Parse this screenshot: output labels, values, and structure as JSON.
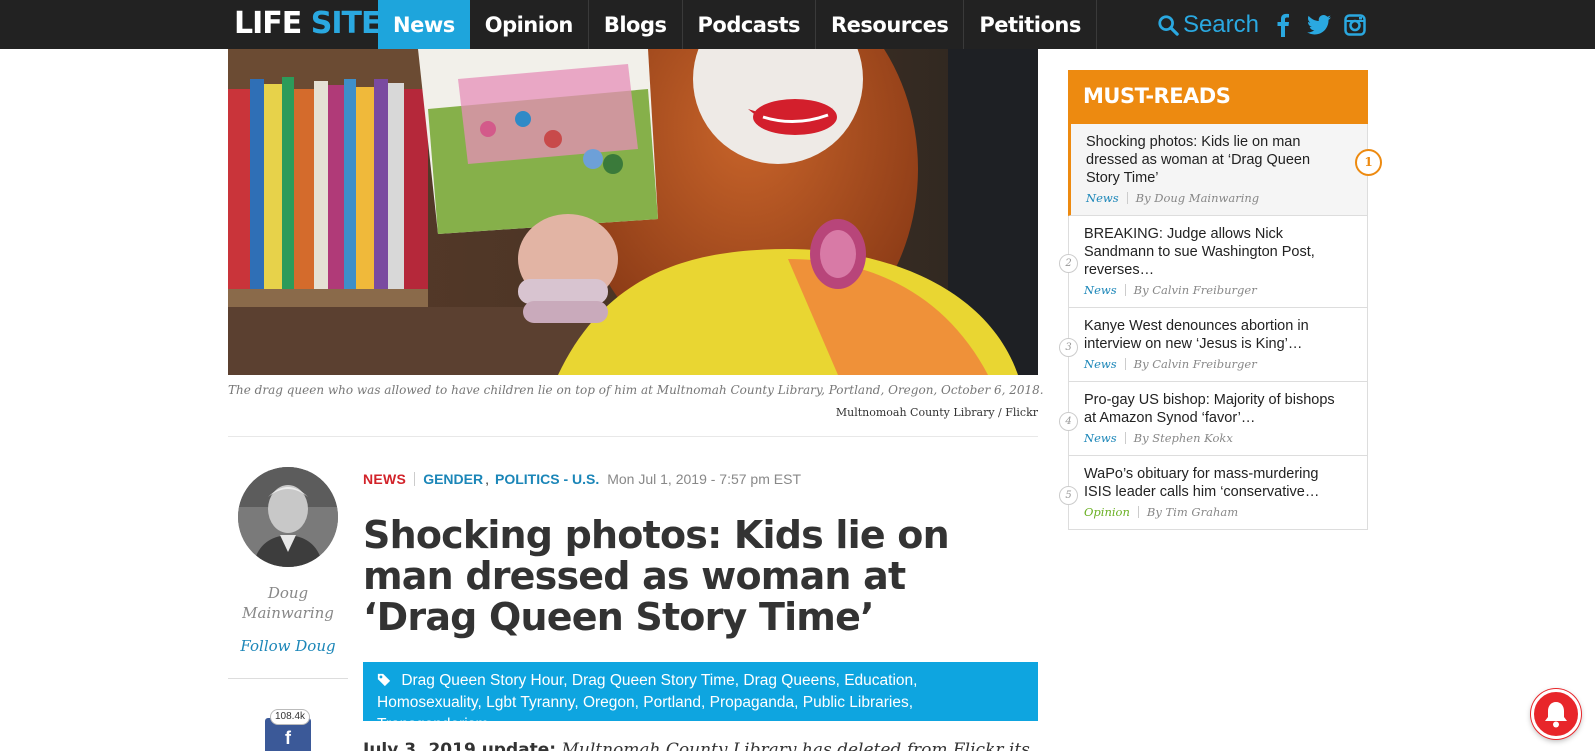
{
  "nav": {
    "logo_part1": "LIFE",
    "logo_part2": "SITE",
    "items": [
      "News",
      "Opinion",
      "Blogs",
      "Podcasts",
      "Resources",
      "Petitions"
    ],
    "active_item": "News",
    "search_label": "Search",
    "social_icons": [
      "facebook-icon",
      "twitter-icon",
      "instagram-icon"
    ]
  },
  "hero": {
    "caption": "The drag queen who was allowed to have children lie on top of him at Multnomah County Library, Portland, Oregon, October 6, 2018.",
    "credit": "Multnomoah County Library / Flickr"
  },
  "author": {
    "name_line1": "Doug",
    "name_line2": "Mainwaring",
    "follow_label": "Follow Doug",
    "share_count": "108.4k",
    "share_icon": "facebook-icon"
  },
  "article": {
    "section": "NEWS",
    "categories": [
      "GENDER",
      "POLITICS - U.S."
    ],
    "date": "Mon Jul 1, 2019 - 7:57 pm EST",
    "title": "Shocking photos: Kids lie on man dressed as woman at ‘Drag Queen Story Time’",
    "tags": [
      "Drag Queen Story Hour",
      "Drag Queen Story Time",
      "Drag Queens",
      "Education",
      "Homosexuality",
      "Lgbt Tyranny",
      "Oregon",
      "Portland",
      "Propaganda",
      "Public Libraries",
      "Transgenderism"
    ],
    "first_para_lead": "July 3, 2019 update:",
    "first_para_text": "Multnomah County Library has deleted from Flickr its"
  },
  "sidebar": {
    "heading": "MUST-READS",
    "items": [
      {
        "num": "1",
        "title": "Shocking photos: Kids lie on man dressed as woman at ‘Drag Queen Story Time’",
        "category": "News",
        "author": "By Doug Mainwaring"
      },
      {
        "num": "2",
        "title": "BREAKING: Judge allows Nick Sandmann to sue Washington Post, reverses…",
        "category": "News",
        "author": "By Calvin Freiburger"
      },
      {
        "num": "3",
        "title": "Kanye West denounces abortion in interview on new ‘Jesus is King’…",
        "category": "News",
        "author": "By Calvin Freiburger"
      },
      {
        "num": "4",
        "title": "Pro-gay US bishop: Majority of bishops at Amazon Synod ‘favor’…",
        "category": "News",
        "author": "By Stephen Kokx"
      },
      {
        "num": "5",
        "title": "WaPo’s obituary for mass-murdering ISIS leader calls him ‘conservative…",
        "category": "Opinion",
        "author": "By Tim Graham"
      }
    ]
  },
  "colors": {
    "nav_bg": "#222222",
    "accent_blue": "#1ea5dc",
    "must_reads_orange": "#ed8a10",
    "news_red": "#d2232a",
    "opinion_green": "#6ab023",
    "notification_red": "#e8262a"
  }
}
